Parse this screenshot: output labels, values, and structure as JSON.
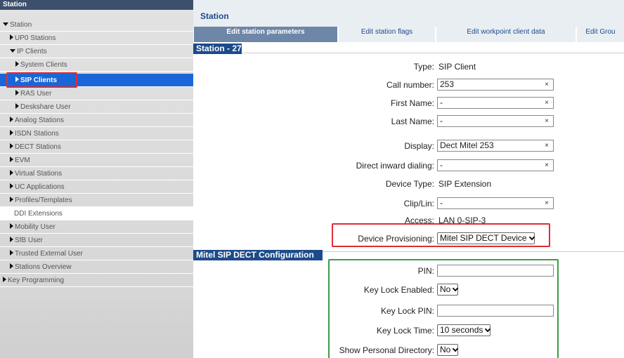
{
  "sidebar": {
    "header": "Station",
    "items": [
      {
        "label": "Station",
        "icon": "triangle-down-icon"
      },
      {
        "label": "UP0 Stations",
        "icon": "triangle-right-icon"
      },
      {
        "label": "IP Clients",
        "icon": "triangle-down-icon"
      },
      {
        "label": "System Clients",
        "icon": "triangle-right-icon"
      },
      {
        "label": "SIP Clients",
        "icon": "triangle-right-icon",
        "selected": true
      },
      {
        "label": "RAS User",
        "icon": "triangle-right-icon"
      },
      {
        "label": "Deskshare User",
        "icon": "triangle-right-icon"
      },
      {
        "label": "Analog Stations",
        "icon": "triangle-right-icon"
      },
      {
        "label": "ISDN Stations",
        "icon": "triangle-right-icon"
      },
      {
        "label": "DECT Stations",
        "icon": "triangle-right-icon"
      },
      {
        "label": "EVM",
        "icon": "triangle-right-icon"
      },
      {
        "label": "Virtual Stations",
        "icon": "triangle-right-icon"
      },
      {
        "label": "UC Applications",
        "icon": "triangle-right-icon"
      },
      {
        "label": "Profiles/Templates",
        "icon": "triangle-right-icon"
      },
      {
        "label": "DDI Extensions",
        "icon": ""
      },
      {
        "label": "Mobility User",
        "icon": "triangle-right-icon"
      },
      {
        "label": "SfB User",
        "icon": "triangle-right-icon"
      },
      {
        "label": "Trusted External User",
        "icon": "triangle-right-icon"
      },
      {
        "label": "Stations Overview",
        "icon": "triangle-right-icon"
      },
      {
        "label": "Key Programming",
        "icon": "triangle-right-icon"
      }
    ]
  },
  "main": {
    "title": "Station",
    "tabs": [
      {
        "label": "Edit station parameters",
        "active": true
      },
      {
        "label": "Edit station flags"
      },
      {
        "label": "Edit workpoint client data"
      },
      {
        "label": "Edit Grou"
      }
    ],
    "station_section": "Station - 27",
    "fields": {
      "type": {
        "label": "Type:",
        "value": "SIP Client"
      },
      "call_number": {
        "label": "Call number:",
        "value": "253"
      },
      "first_name": {
        "label": "First Name:",
        "value": "-"
      },
      "last_name": {
        "label": "Last Name:",
        "value": "-"
      },
      "display": {
        "label": "Display:",
        "value": "Dect Mitel 253"
      },
      "did": {
        "label": "Direct inward dialing:",
        "value": "-"
      },
      "device_type": {
        "label": "Device Type:",
        "value": "SIP Extension"
      },
      "clip_lin": {
        "label": "Clip/Lin:",
        "value": "-"
      },
      "access": {
        "label": "Access:",
        "value": "LAN 0-SIP-3"
      },
      "device_provisioning": {
        "label": "Device Provisioning:",
        "value": "Mitel SIP DECT Device"
      }
    },
    "dect_section": "Mitel SIP DECT Configuration",
    "dect_fields": {
      "pin": {
        "label": "PIN:",
        "value": ""
      },
      "key_lock_enabled": {
        "label": "Key Lock Enabled:",
        "value": "No"
      },
      "key_lock_pin": {
        "label": "Key Lock PIN:",
        "value": ""
      },
      "key_lock_time": {
        "label": "Key Lock Time:",
        "value": "10 seconds"
      },
      "show_personal_directory": {
        "label": "Show Personal Directory:",
        "value": "No"
      }
    },
    "clear_symbol": "×"
  },
  "colors": {
    "sidebar_header": "#3c4f6c",
    "selected": "#1a66d8",
    "title": "#1d4b8a",
    "highlight_red": "#e02c36",
    "highlight_green": "#3a9d4a"
  }
}
